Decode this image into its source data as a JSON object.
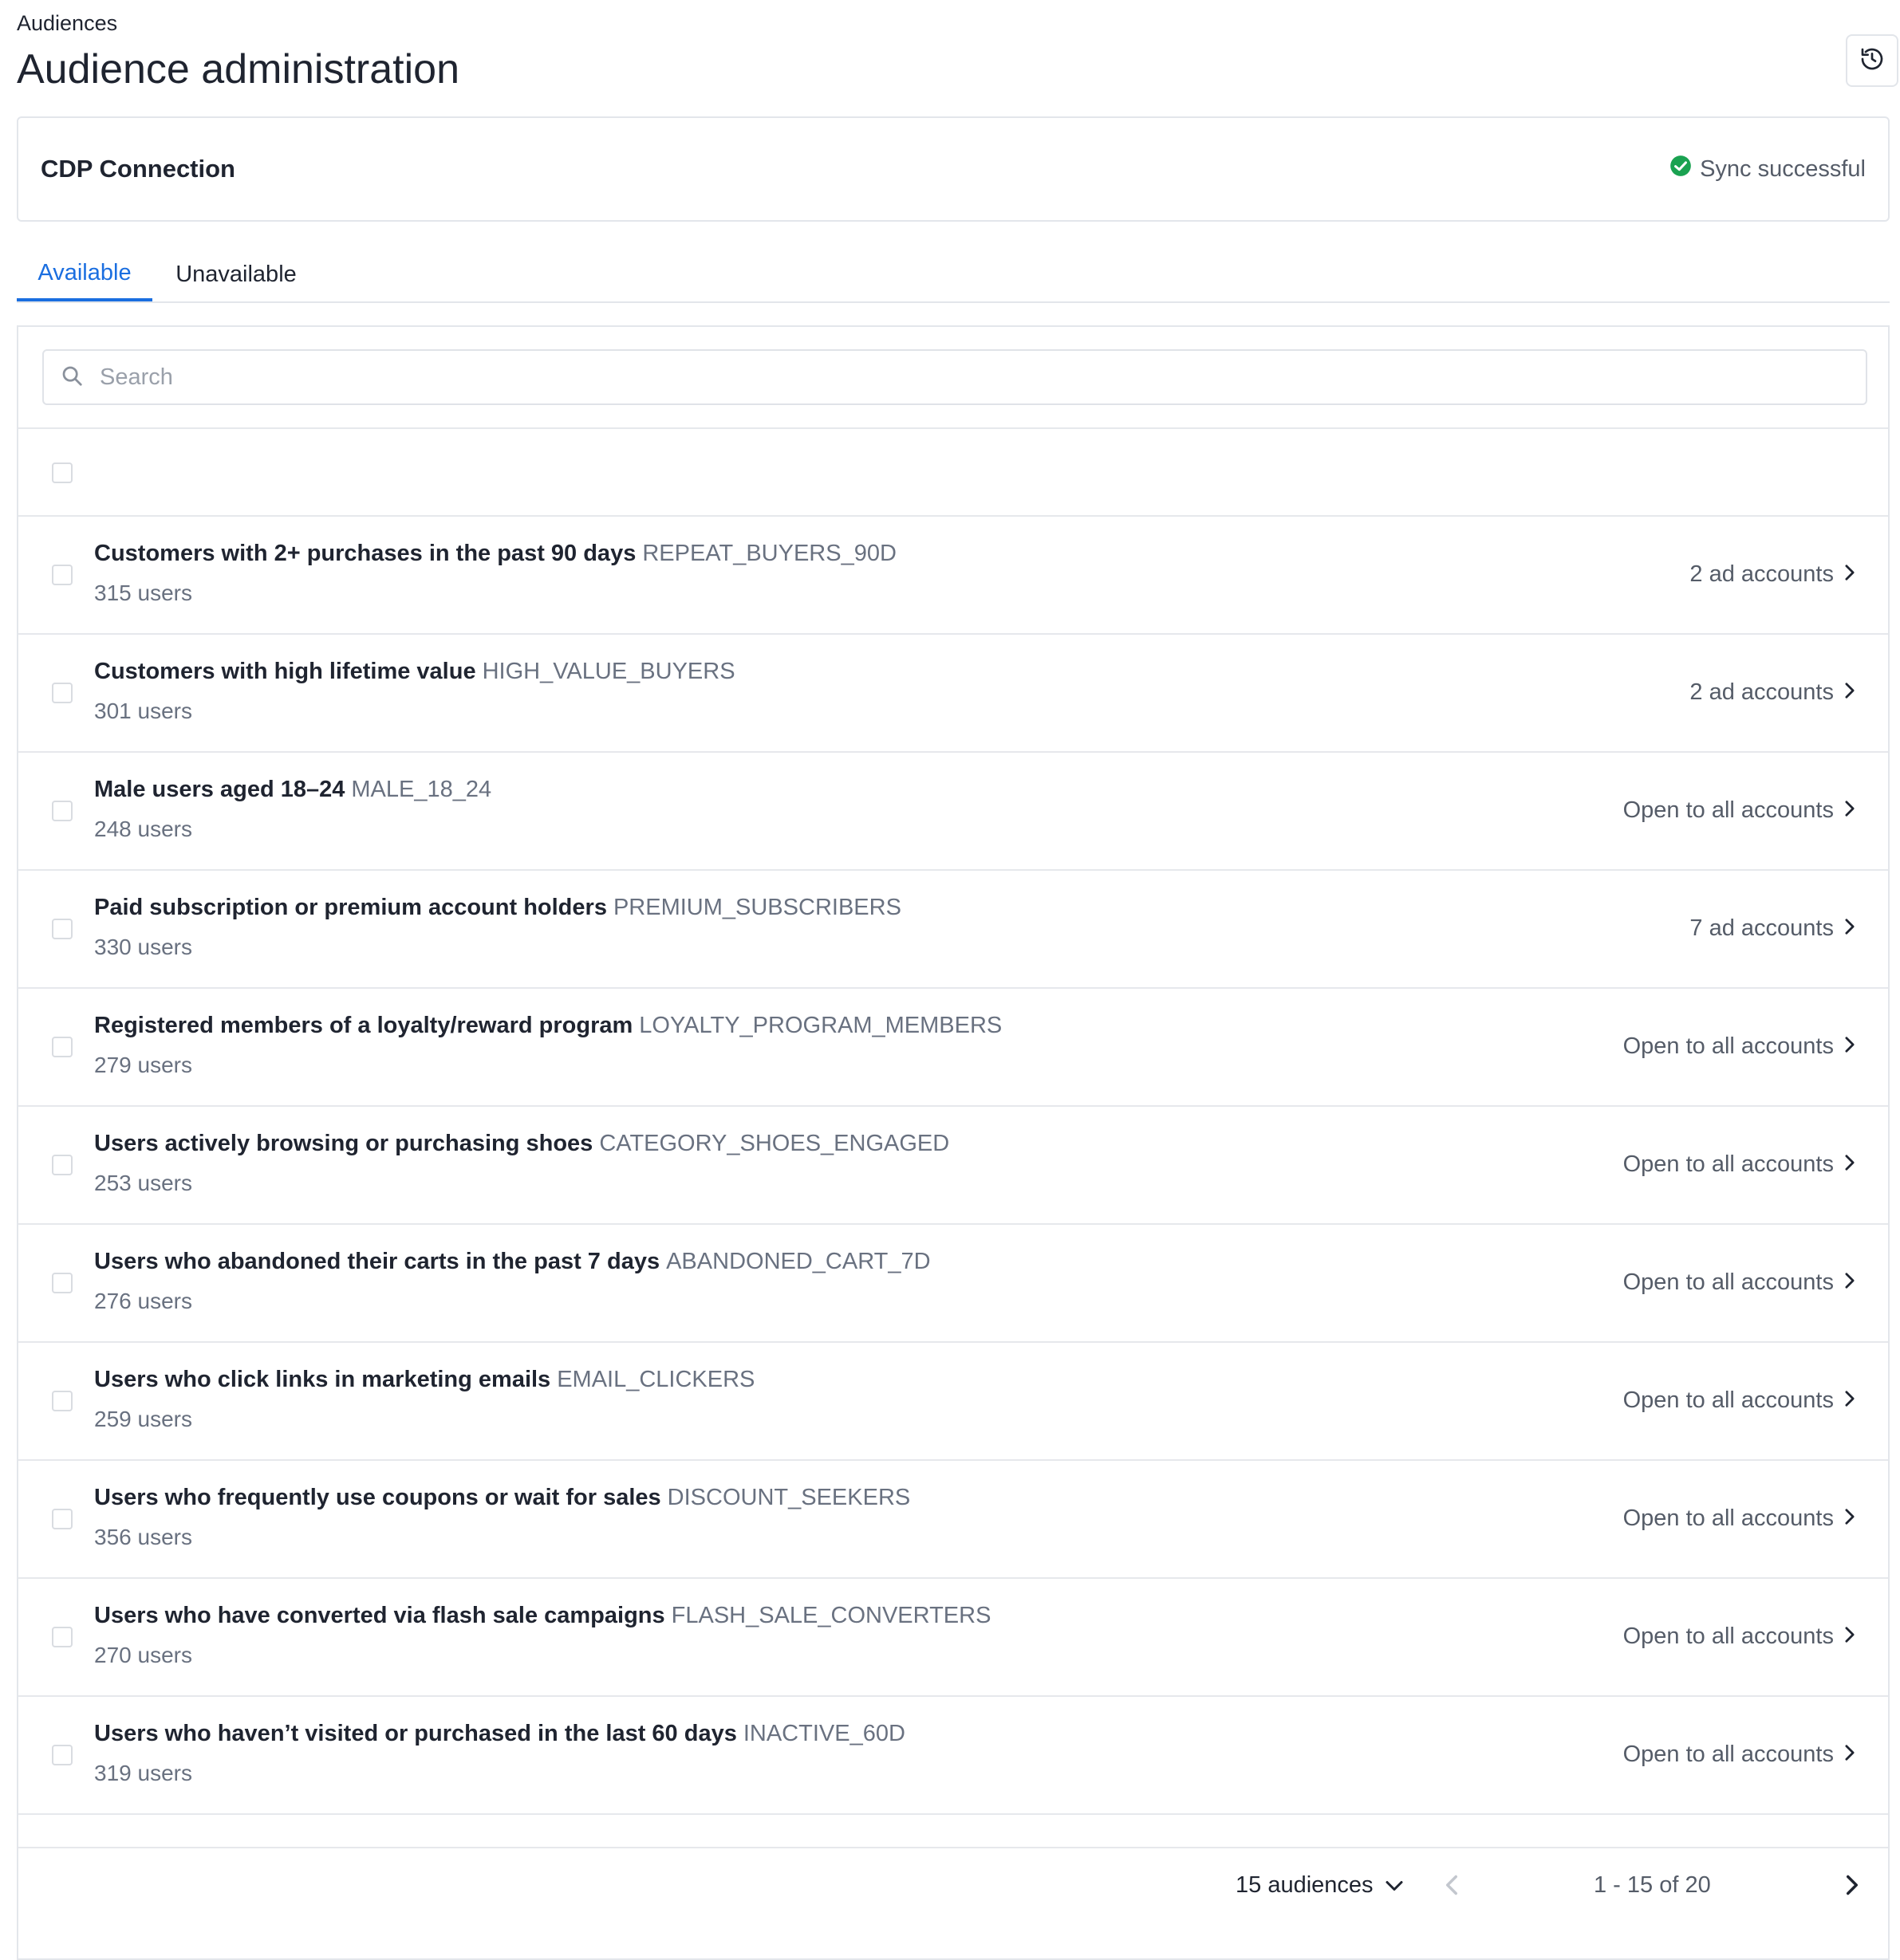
{
  "breadcrumb": "Audiences",
  "title": "Audience administration",
  "cdp": {
    "title": "CDP Connection",
    "status": "Sync successful",
    "status_color": "#1aa251"
  },
  "tabs": [
    {
      "label": "Available",
      "active": true
    },
    {
      "label": "Unavailable",
      "active": false
    }
  ],
  "search": {
    "placeholder": "Search",
    "value": ""
  },
  "audiences": [
    {
      "name": "Customers with 2+ purchases in the past 90 days",
      "code": "REPEAT_BUYERS_90D",
      "users": "315 users",
      "access": "2 ad accounts"
    },
    {
      "name": "Customers with high lifetime value",
      "code": "HIGH_VALUE_BUYERS",
      "users": "301 users",
      "access": "2 ad accounts"
    },
    {
      "name": "Male users aged 18–24",
      "code": "MALE_18_24",
      "users": "248 users",
      "access": "Open to all accounts"
    },
    {
      "name": "Paid subscription or premium account holders",
      "code": "PREMIUM_SUBSCRIBERS",
      "users": "330 users",
      "access": "7 ad accounts"
    },
    {
      "name": "Registered members of a loyalty/reward program",
      "code": "LOYALTY_PROGRAM_MEMBERS",
      "users": "279 users",
      "access": "Open to all accounts"
    },
    {
      "name": "Users actively browsing or purchasing shoes",
      "code": "CATEGORY_SHOES_ENGAGED",
      "users": "253 users",
      "access": "Open to all accounts"
    },
    {
      "name": "Users who abandoned their carts in the past 7 days",
      "code": "ABANDONED_CART_7D",
      "users": "276 users",
      "access": "Open to all accounts"
    },
    {
      "name": "Users who click links in marketing emails",
      "code": "EMAIL_CLICKERS",
      "users": "259 users",
      "access": "Open to all accounts"
    },
    {
      "name": "Users who frequently use coupons or wait for sales",
      "code": "DISCOUNT_SEEKERS",
      "users": "356 users",
      "access": "Open to all accounts"
    },
    {
      "name": "Users who have converted via flash sale campaigns",
      "code": "FLASH_SALE_CONVERTERS",
      "users": "270 users",
      "access": "Open to all accounts"
    },
    {
      "name": "Users who haven’t visited or purchased in the last 60 days",
      "code": "INACTIVE_60D",
      "users": "319 users",
      "access": "Open to all accounts"
    }
  ],
  "pagination": {
    "page_size": "15 audiences",
    "range": "1 - 15 of 20"
  },
  "colors": {
    "accent": "#1a6ee0",
    "text": "#1f2430",
    "muted": "#697180",
    "border": "#e3e6eb"
  }
}
